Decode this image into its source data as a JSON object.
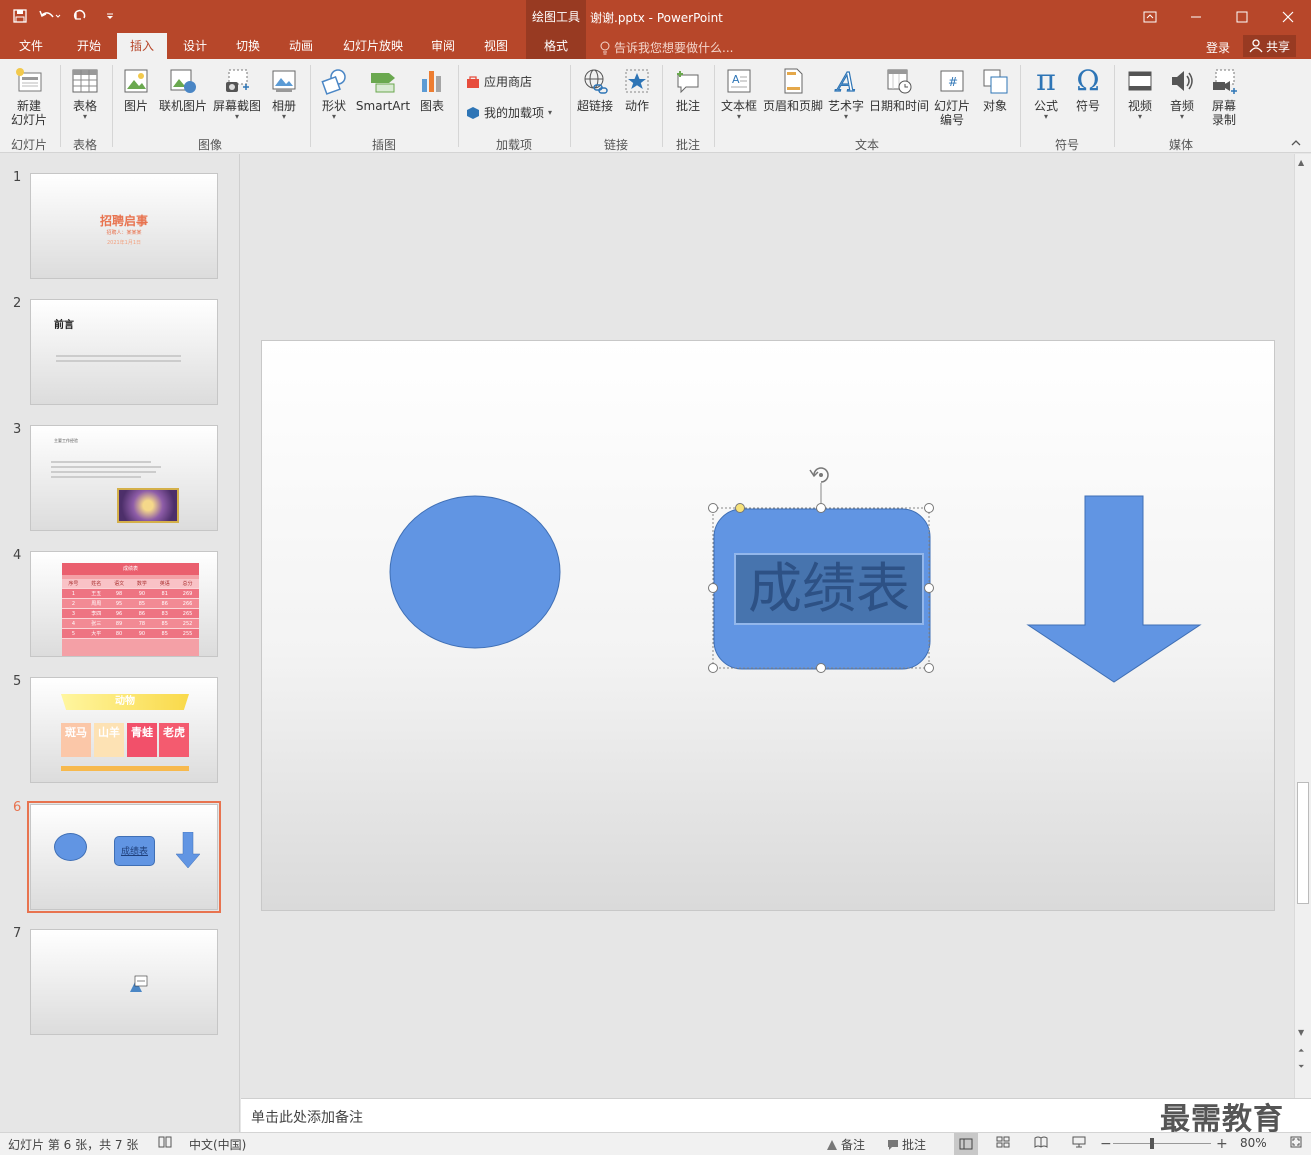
{
  "window": {
    "contextual_group": "绘图工具",
    "doc_title": "谢谢.pptx - PowerPoint",
    "accent": "#b7472a",
    "dark_accent": "#983a22"
  },
  "tabs": [
    {
      "label": "文件",
      "active": false
    },
    {
      "label": "开始",
      "active": false
    },
    {
      "label": "插入",
      "active": true
    },
    {
      "label": "设计",
      "active": false
    },
    {
      "label": "切换",
      "active": false
    },
    {
      "label": "动画",
      "active": false
    },
    {
      "label": "幻灯片放映",
      "active": false
    },
    {
      "label": "审阅",
      "active": false
    },
    {
      "label": "视图",
      "active": false
    },
    {
      "label": "格式",
      "active": false
    }
  ],
  "tell_me": "告诉我您想要做什么...",
  "signin": "登录",
  "share": "共享",
  "ribbon": {
    "new_slide_1": "新建",
    "new_slide_2": "幻灯片",
    "table": "表格",
    "picture": "图片",
    "online_picture": "联机图片",
    "screenshot": "屏幕截图",
    "album": "相册",
    "shapes": "形状",
    "smartart": "SmartArt",
    "chart": "图表",
    "store": "应用商店",
    "my_addins": "我的加载项",
    "hyperlink": "超链接",
    "action": "动作",
    "comment": "批注",
    "textbox": "文本框",
    "header_footer": "页眉和页脚",
    "wordart": "艺术字",
    "datetime": "日期和时间",
    "slide_num_1": "幻灯片",
    "slide_num_2": "编号",
    "object": "对象",
    "equation": "公式",
    "symbol": "符号",
    "video": "视频",
    "audio": "音频",
    "screen_rec_1": "屏幕",
    "screen_rec_2": "录制",
    "groups": {
      "slides": "幻灯片",
      "tables": "表格",
      "images": "图像",
      "illustrations": "插图",
      "addins": "加载项",
      "links": "链接",
      "comments": "批注",
      "text": "文本",
      "symbols": "符号",
      "media": "媒体"
    }
  },
  "thumbnails": [
    {
      "num": "1",
      "title": "招聘启事",
      "sub1": "招聘人：某某某",
      "sub2": "2021年1月1日"
    },
    {
      "num": "2",
      "title": "前言"
    },
    {
      "num": "3",
      "title": "主要工作经验"
    },
    {
      "num": "4",
      "title": "成绩表",
      "headers": [
        "序号",
        "姓名",
        "语文",
        "数学",
        "英语",
        "总分"
      ],
      "rows": [
        [
          "1",
          "王五",
          "98",
          "90",
          "81",
          "269"
        ],
        [
          "2",
          "周周",
          "95",
          "85",
          "86",
          "266"
        ],
        [
          "3",
          "李四",
          "96",
          "86",
          "83",
          "265"
        ],
        [
          "4",
          "张三",
          "89",
          "78",
          "85",
          "252"
        ],
        [
          "5",
          "大平",
          "80",
          "90",
          "85",
          "255"
        ]
      ]
    },
    {
      "num": "5",
      "title": "动物",
      "cards": [
        "斑马",
        "山羊",
        "青蛙",
        "老虎"
      ]
    },
    {
      "num": "6",
      "label": "成绩表"
    },
    {
      "num": "7"
    }
  ],
  "slide": {
    "textbox": "成绩表",
    "shape_color": "#6195e3"
  },
  "notes_placeholder": "单击此处添加备注",
  "watermark": "最需教育",
  "status": {
    "slide_info": "幻灯片 第 6 张，共 7 张",
    "language": "中文(中国)",
    "notes": "备注",
    "comments": "批注",
    "zoom": "80%"
  }
}
